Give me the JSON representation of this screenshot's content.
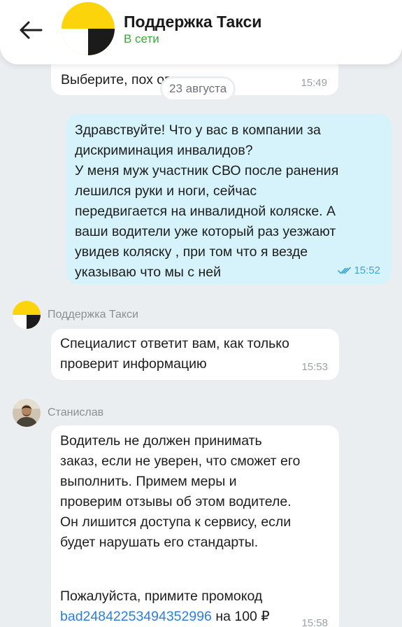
{
  "header": {
    "title": "Поддержка Такси",
    "status": "В сети",
    "back_icon": "arrow-left-icon",
    "avatar_icon": "yandex-taxi-logo",
    "status_color": "#3aa935"
  },
  "date_divider": "23 августа",
  "messages": [
    {
      "direction": "incoming",
      "text": "Выберите, пох                   опрос",
      "time": "15:49"
    },
    {
      "direction": "outgoing",
      "text": "Здравствуйте! Что у вас в компании за\nдискриминация инвалидов?\nУ меня муж участник СВО после ранения\nлешился руки и ноги, сейчас\nпередвигается на инвалидной коляске. А\nваши водители уже который раз уезжают\nувидев коляску , при том что я везде\nуказываю что мы с ней",
      "time": "15:52",
      "read_icon": "double-check-icon"
    },
    {
      "direction": "incoming",
      "sender": "Поддержка Такси",
      "text": "Специалист ответит вам, как только\nпроверит информацию",
      "time": "15:53"
    },
    {
      "direction": "incoming",
      "sender": "Станислав",
      "text": "Водитель не должен принимать\nзаказ, если не уверен, что сможет его\nвыполнить. Примем меры и\nпроверим отзывы об этом водителе.\nОн лишится доступа к сервису, если\nбудет нарушать его стандарты.",
      "promo_prefix": "Пожалуйста, примите промокод",
      "promo_code": "bad24842253494352996",
      "promo_suffix": " на 100 ₽",
      "time": "15:58"
    }
  ],
  "colors": {
    "background": "#ebeef1",
    "outgoing_bubble": "#d6f3fb",
    "incoming_bubble": "#ffffff",
    "link": "#2b7fe0",
    "brand_yellow": "#fcd40c"
  }
}
